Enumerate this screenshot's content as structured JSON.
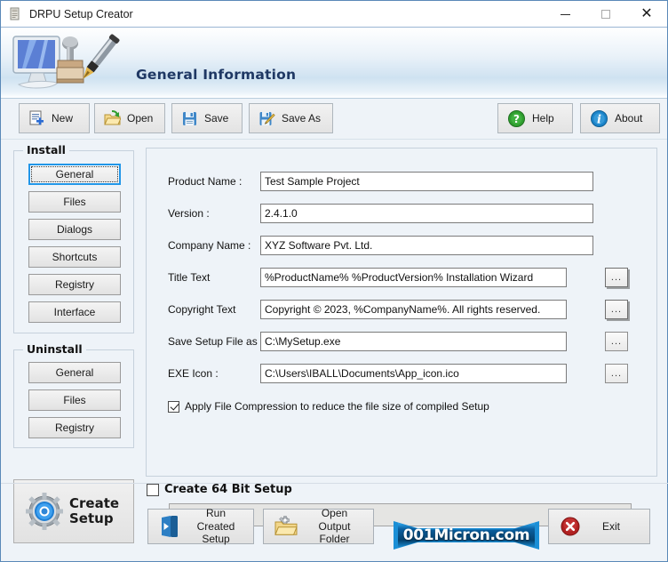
{
  "window": {
    "title": "DRPU Setup Creator",
    "app_icon": "setup-creator-icon",
    "minimize_label": "Minimize",
    "maximize_label": "Maximize",
    "close_label": "Close"
  },
  "header": {
    "title": "General Information",
    "logo_icon": "monitor-stamp-pen-icon"
  },
  "toolbar": {
    "buttons": [
      {
        "label": "New",
        "icon": "new-document-icon"
      },
      {
        "label": "Open",
        "icon": "open-folder-icon"
      },
      {
        "label": "Save",
        "icon": "floppy-disk-icon"
      },
      {
        "label": "Save As",
        "icon": "floppy-disk-pencil-icon"
      }
    ],
    "right_buttons": [
      {
        "label": "Help",
        "icon": "question-mark-icon"
      },
      {
        "label": "About",
        "icon": "info-icon"
      }
    ]
  },
  "sidebar": {
    "install": {
      "title": "Install",
      "items": [
        {
          "label": "General",
          "selected": true
        },
        {
          "label": "Files",
          "selected": false
        },
        {
          "label": "Dialogs",
          "selected": false
        },
        {
          "label": "Shortcuts",
          "selected": false
        },
        {
          "label": "Registry",
          "selected": false
        },
        {
          "label": "Interface",
          "selected": false
        }
      ]
    },
    "uninstall": {
      "title": "Uninstall",
      "items": [
        {
          "label": "General",
          "selected": false
        },
        {
          "label": "Files",
          "selected": false
        },
        {
          "label": "Registry",
          "selected": false
        }
      ]
    },
    "create_setup": {
      "line1": "Create",
      "line2": "Setup",
      "icon": "gear-icon"
    }
  },
  "form": {
    "fields": [
      {
        "label": "Product Name :",
        "value": "Test Sample Project",
        "browse": false
      },
      {
        "label": "Version :",
        "value": "2.4.1.0",
        "browse": false
      },
      {
        "label": "Company Name :",
        "value": "XYZ Software Pvt. Ltd.",
        "browse": false
      },
      {
        "label": "Title Text",
        "value": "%ProductName% %ProductVersion% Installation Wizard",
        "browse": true
      },
      {
        "label": "Copyright Text",
        "value": "Copyright © 2023, %CompanyName%. All rights reserved.",
        "browse": true
      },
      {
        "label": "Save Setup File as :",
        "value": "C:\\MySetup.exe",
        "browse": true
      },
      {
        "label": "EXE Icon :",
        "value": "C:\\Users\\IBALL\\Documents\\App_icon.ico",
        "browse": true
      }
    ],
    "browse_label": "...",
    "compression": {
      "label": "Apply File Compression to reduce the file size of compiled Setup",
      "checked": true
    },
    "progress": {
      "value": 0,
      "label": ""
    }
  },
  "bottom": {
    "create_64bit": {
      "label": "Create 64 Bit Setup",
      "checked": false
    },
    "buttons": [
      {
        "label": "Run Created\nSetup",
        "icon": "run-setup-icon"
      },
      {
        "label": "Open Output\nFolder",
        "icon": "output-folder-icon"
      }
    ],
    "exit": {
      "label": "Exit",
      "icon": "close-circle-icon"
    },
    "brand": {
      "text": "001Micron.com"
    }
  },
  "colors": {
    "accent_blue": "#2196e8",
    "header_title": "#1f3864",
    "panel_bg": "#eef3f8",
    "brand_blue": "#0a5fa0",
    "help_green": "#2f9e2f",
    "about_blue": "#1b84c9",
    "exit_red": "#c02626"
  }
}
